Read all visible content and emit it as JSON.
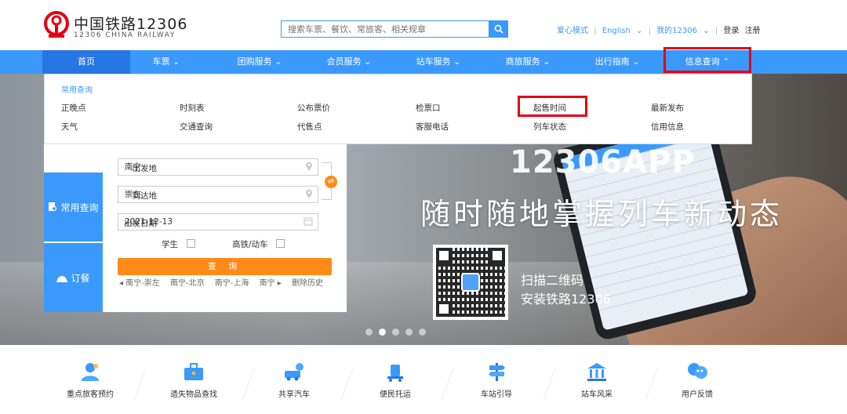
{
  "brand": {
    "name_cn": "中国铁路12306",
    "name_en": "12306 CHINA RAILWAY"
  },
  "search": {
    "placeholder": "搜索车票、餐饮、常旅客、相关规章"
  },
  "toplinks": {
    "care": "爱心模式",
    "english": "English",
    "my12306": "我的12306",
    "login": "登录",
    "register": "注册"
  },
  "nav": [
    {
      "label": "首页"
    },
    {
      "label": "车票 ⌄"
    },
    {
      "label": "团购服务 ⌄"
    },
    {
      "label": "会员服务 ⌄"
    },
    {
      "label": "站车服务 ⌄"
    },
    {
      "label": "商旅服务 ⌄"
    },
    {
      "label": "出行指南 ⌄"
    },
    {
      "label": "信息查询 ⌃"
    }
  ],
  "dropdown": {
    "title": "常用查询",
    "col1": [
      "正晚点",
      "天气"
    ],
    "col2": [
      "时刻表",
      "交通查询"
    ],
    "col3": [
      "公布票价",
      "代售点"
    ],
    "col4": [
      "检票口",
      "客服电话"
    ],
    "col5": [
      "起售时间",
      "列车状态"
    ],
    "col6": [
      "最新发布",
      "信用信息"
    ]
  },
  "form": {
    "tab_query": "常用查询",
    "tab_meal": "订餐",
    "from_label": "出发地",
    "from_value": "南宁",
    "to_label": "到达地",
    "to_value": "崇左",
    "date_label": "出发日期",
    "date_value": "2021-12-13",
    "student_label": "学生",
    "highspeed_label": "高铁/动车",
    "submit": "查 询",
    "history": [
      "◂ 南宁-崇左",
      "南宁-北京",
      "南宁-上海",
      "南宁 ▸",
      "删除历史"
    ]
  },
  "hero": {
    "title": "12306APP",
    "slogan": "随时随地掌握列车新动态",
    "scan_line1": "扫描二维码",
    "scan_line2": "安装铁路12306"
  },
  "services": [
    {
      "label": "重点旅客预约",
      "icon": "person-assist-icon"
    },
    {
      "label": "遗失物品查找",
      "icon": "briefcase-icon"
    },
    {
      "label": "共享汽车",
      "icon": "car-share-icon"
    },
    {
      "label": "便民托运",
      "icon": "luggage-cart-icon"
    },
    {
      "label": "车站引导",
      "icon": "signpost-icon"
    },
    {
      "label": "站车风采",
      "icon": "station-building-icon"
    },
    {
      "label": "用户反馈",
      "icon": "feedback-chat-icon"
    }
  ],
  "colors": {
    "primary": "#3b99fc",
    "primary_dark": "#2676e3",
    "accent": "#ff8a1a",
    "highlight_red": "#e60012"
  }
}
